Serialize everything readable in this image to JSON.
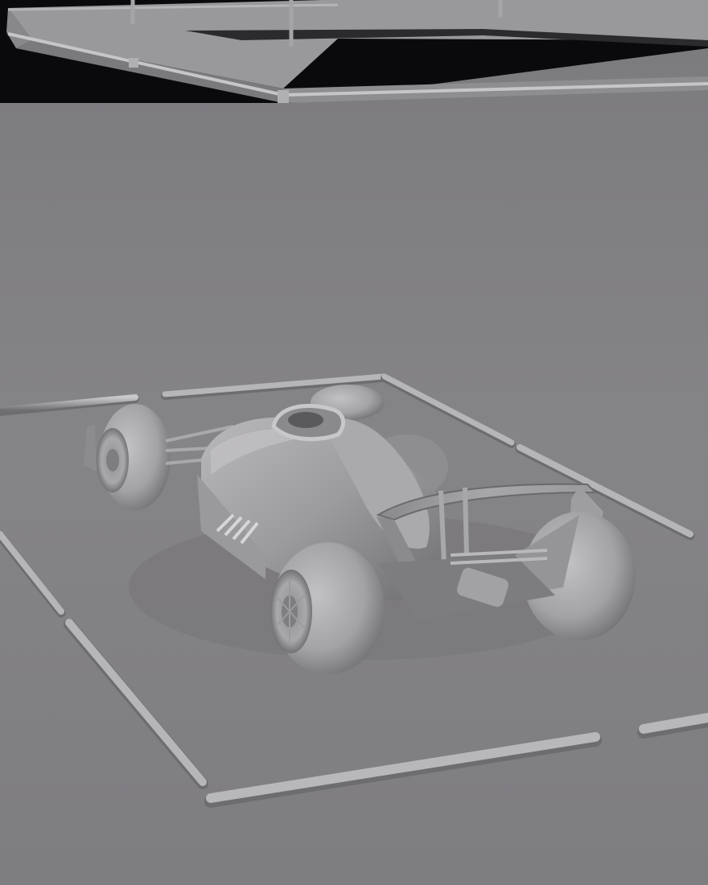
{
  "scene": {
    "kind": "clay-render",
    "subject": "formula-one-race-car",
    "colors": {
      "sky": "#0a0a0c",
      "floor": "#838286",
      "floor_shadow": "#77767a",
      "rail": "#9c9b9e",
      "rail_highlight": "#c4c3c6",
      "rail_shadow": "#6b6a6d",
      "car_body": "#9a999c",
      "car_highlight": "#c7c6c9",
      "car_shadow": "#5f5e61",
      "tyre": "#a4a3a6",
      "tyre_dark": "#6f6e71"
    }
  }
}
